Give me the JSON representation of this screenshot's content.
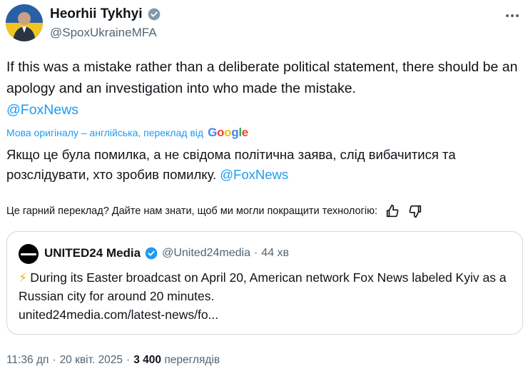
{
  "author": {
    "name": "Heorhii Tykhyi",
    "handle": "@SpoxUkraineMFA"
  },
  "tweet": {
    "text": "If this was a mistake rather than a deliberate political statement, there should be an apology and an investigation into who made the mistake.",
    "mention": "@FoxNews"
  },
  "translation": {
    "note": "Мова оригіналу – англійська, переклад від",
    "provider": "Google",
    "text": "Якщо це була помилка, а не свідома політична заява, слід вибачитися та розслідувати, хто зробив помилку.",
    "mention": "@FoxNews",
    "feedback_question": "Це гарний переклад? Дайте нам знати, щоб ми могли покращити технологію:"
  },
  "quote": {
    "name": "UNITED24 Media",
    "handle": "@United24media",
    "separator": "·",
    "time": "44 хв",
    "text": "During its Easter broadcast on April 20, American network Fox News labeled Kyiv as a Russian city for around 20 minutes.",
    "link": "united24media.com/latest-news/fo..."
  },
  "meta": {
    "time": "11:36 дп",
    "separator1": "·",
    "date": "20 квіт. 2025",
    "separator2": "·",
    "views_count": "3 400",
    "views_label": "переглядів"
  },
  "colors": {
    "accent": "#1d9bf0",
    "text": "#0f1419",
    "muted": "#536471",
    "border": "#cfd9de"
  },
  "icons": {
    "verified": "verified-badge-icon",
    "more": "more-options-icon",
    "like": "thumbs-up-icon",
    "dislike": "thumbs-down-icon",
    "bolt": "lightning-icon"
  }
}
